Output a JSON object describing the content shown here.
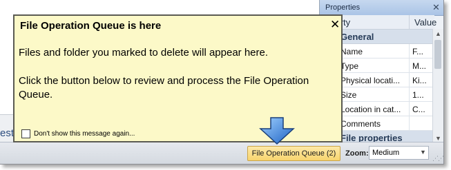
{
  "left_pane": {
    "cut_text": "est"
  },
  "properties": {
    "title": "Properties",
    "close_glyph": "✕",
    "columns": {
      "property": "operty",
      "value": "Value"
    },
    "categories": [
      {
        "label": "General"
      },
      {
        "label": "File properties"
      }
    ],
    "rows": [
      {
        "name": "Name",
        "value": "F..."
      },
      {
        "name": "Type",
        "value": "M..."
      },
      {
        "name": "Physical locati...",
        "value": "Ki..."
      },
      {
        "name": "Size",
        "value": "1..."
      },
      {
        "name": "Location in cat...",
        "value": "C..."
      },
      {
        "name": "Comments",
        "value": ""
      }
    ]
  },
  "statusbar": {
    "queue_button": "File Operation Queue (2)",
    "zoom_label": "Zoom:",
    "zoom_value": "Medium"
  },
  "balloon": {
    "title": "File Operation Queue is here",
    "close_glyph": "✕",
    "paragraph1": "Files and folder you marked to delete will appear here.",
    "paragraph2": "Click the button below to review and process the File Operation Queue.",
    "checkbox_label": "Don't show this message again..."
  },
  "colors": {
    "balloon_bg": "#fcf9c8",
    "arrow_fill": "#2f7fd8",
    "queue_button_bg": "#f8d46e"
  }
}
